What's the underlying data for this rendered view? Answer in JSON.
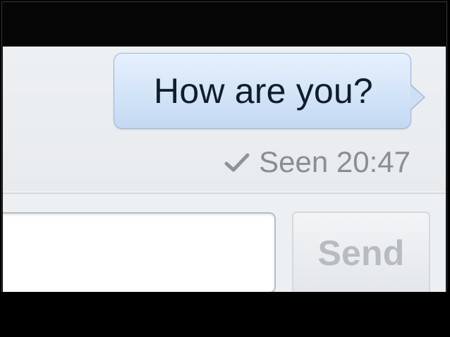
{
  "conversation": {
    "messages": [
      {
        "text": "How are you?",
        "status": "Seen 20:47"
      }
    ]
  },
  "composer": {
    "input_value": "",
    "emoji_icon": "smiley-face-icon",
    "send_label": "Send"
  },
  "icons": {
    "seen": "checkmark-icon",
    "emoji": "smiley-face-icon"
  },
  "colors": {
    "bubble": "#d4e5f8",
    "bubble_border": "#9fb7d7",
    "message_text": "#111c2d",
    "status_text": "#8a8d91",
    "disabled_send_text": "#b8bbbf",
    "page_background": "#e9ebee"
  }
}
